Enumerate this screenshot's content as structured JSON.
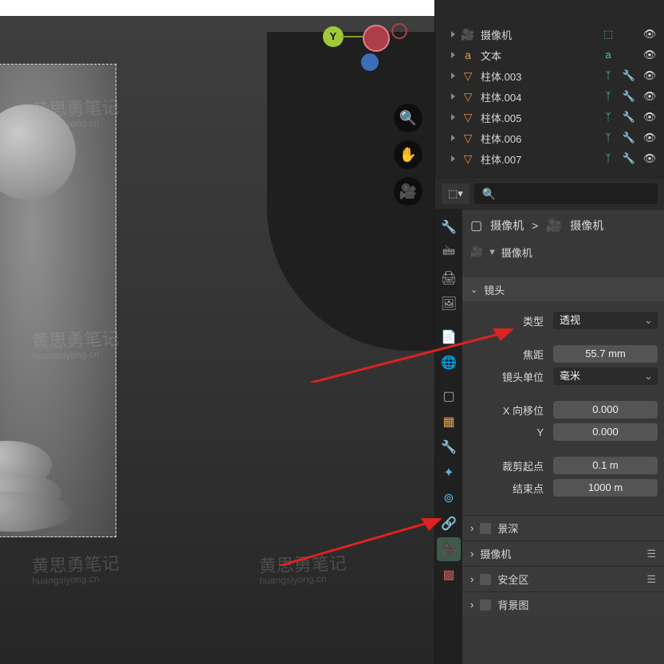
{
  "outliner": {
    "items": [
      {
        "label": "摄像机",
        "type": "cam",
        "type_icon": "⬚",
        "data_color": "#49c",
        "eye": true
      },
      {
        "label": "文本",
        "type": "text",
        "type_icon": "a",
        "data_color": "#49c",
        "eye": true
      },
      {
        "label": "柱体.003",
        "type": "mesh",
        "type_icon": "▽",
        "data_color": "#4c9",
        "eye": true
      },
      {
        "label": "柱体.004",
        "type": "mesh",
        "type_icon": "▽",
        "data_color": "#4c9",
        "eye": true
      },
      {
        "label": "柱体.005",
        "type": "mesh",
        "type_icon": "▽",
        "data_color": "#4c9",
        "eye": true
      },
      {
        "label": "柱体.006",
        "type": "mesh",
        "type_icon": "▽",
        "data_color": "#4c9",
        "eye": true
      },
      {
        "label": "柱体.007",
        "type": "mesh",
        "type_icon": "▽",
        "data_color": "#4c9",
        "eye": true
      }
    ]
  },
  "search": {
    "placeholder": "🔍"
  },
  "breadcrumb": {
    "obj": "摄像机",
    "data": "摄像机",
    "sep": ">"
  },
  "obj_data_row": {
    "label": "摄像机"
  },
  "lens_panel_title": "镜头",
  "props": {
    "type_label": "类型",
    "type_value": "透视",
    "focal_label": "焦距",
    "focal_value": "55.7 mm",
    "unit_label": "镜头单位",
    "unit_value": "毫米",
    "shiftx_label": "X 向移位",
    "shiftx_value": "0.000",
    "shifty_label": "Y",
    "shifty_value": "0.000",
    "clip_start_label": "裁剪起点",
    "clip_start_value": "0.1 m",
    "clip_end_label": "结束点",
    "clip_end_value": "1000 m"
  },
  "sections": {
    "dof": "景深",
    "camera": "摄像机",
    "safe": "安全区",
    "bg": "背景图"
  },
  "axis": {
    "y": "Y"
  }
}
